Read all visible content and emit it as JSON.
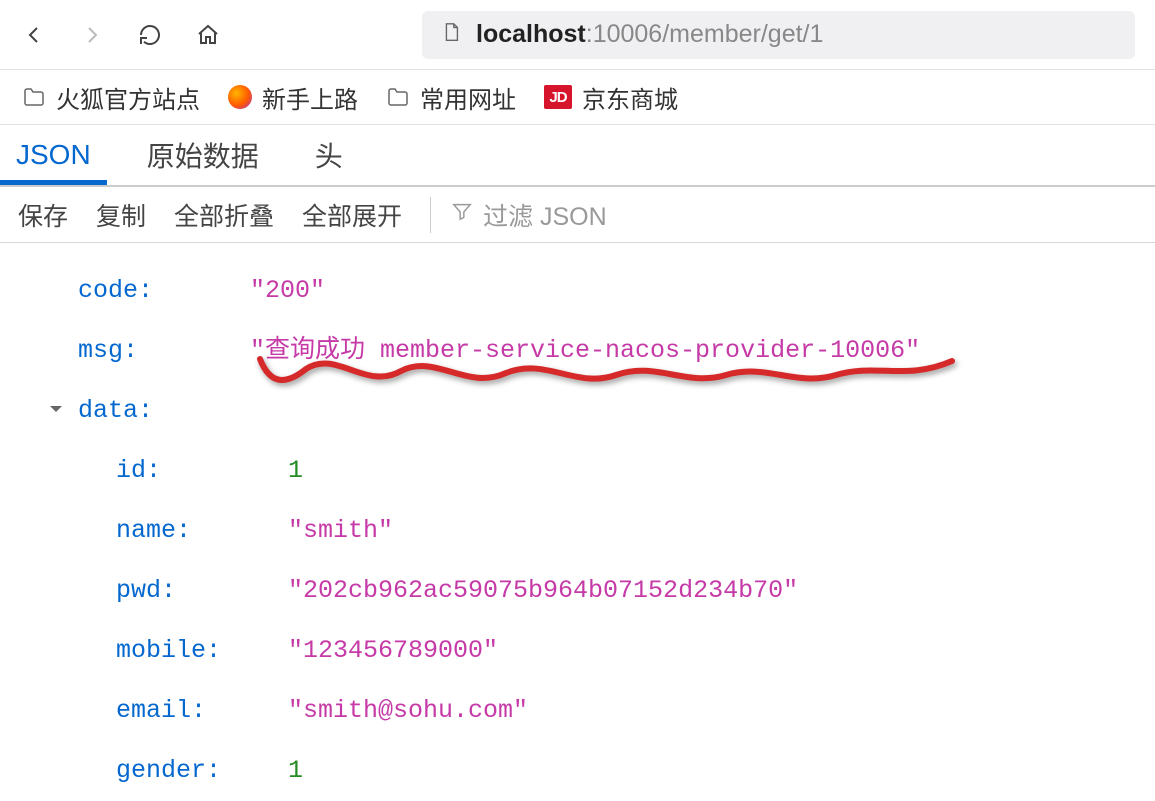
{
  "nav": {
    "url_host": "localhost",
    "url_port": ":10006",
    "url_path": "/member/get/1"
  },
  "bookmarks": [
    {
      "label": "火狐官方站点",
      "icon": "folder"
    },
    {
      "label": "新手上路",
      "icon": "firefox"
    },
    {
      "label": "常用网址",
      "icon": "folder"
    },
    {
      "label": "京东商城",
      "icon": "jd",
      "badge": "JD"
    }
  ],
  "tabs": [
    {
      "label": "JSON",
      "active": true
    },
    {
      "label": "原始数据",
      "active": false
    },
    {
      "label": "头",
      "active": false
    }
  ],
  "toolbar": {
    "save": "保存",
    "copy": "复制",
    "collapse_all": "全部折叠",
    "expand_all": "全部展开",
    "filter_placeholder": "过滤 JSON"
  },
  "json": {
    "rows": [
      {
        "indent": 1,
        "key": "code:",
        "value": "\"200\"",
        "type": "string",
        "toggle": false
      },
      {
        "indent": 1,
        "key": "msg:",
        "value": "\"查询成功 member-service-nacos-provider-10006\"",
        "type": "string",
        "toggle": false
      },
      {
        "indent": 1,
        "key": "data:",
        "value": "",
        "type": "object",
        "toggle": true
      },
      {
        "indent": 2,
        "key": "id:",
        "value": "1",
        "type": "number",
        "toggle": false
      },
      {
        "indent": 2,
        "key": "name:",
        "value": "\"smith\"",
        "type": "string",
        "toggle": false
      },
      {
        "indent": 2,
        "key": "pwd:",
        "value": "\"202cb962ac59075b964b07152d234b70\"",
        "type": "string",
        "toggle": false
      },
      {
        "indent": 2,
        "key": "mobile:",
        "value": "\"123456789000\"",
        "type": "string",
        "toggle": false
      },
      {
        "indent": 2,
        "key": "email:",
        "value": "\"smith@sohu.com\"",
        "type": "string",
        "toggle": false
      },
      {
        "indent": 2,
        "key": "gender:",
        "value": "1",
        "type": "number",
        "toggle": false
      }
    ]
  }
}
